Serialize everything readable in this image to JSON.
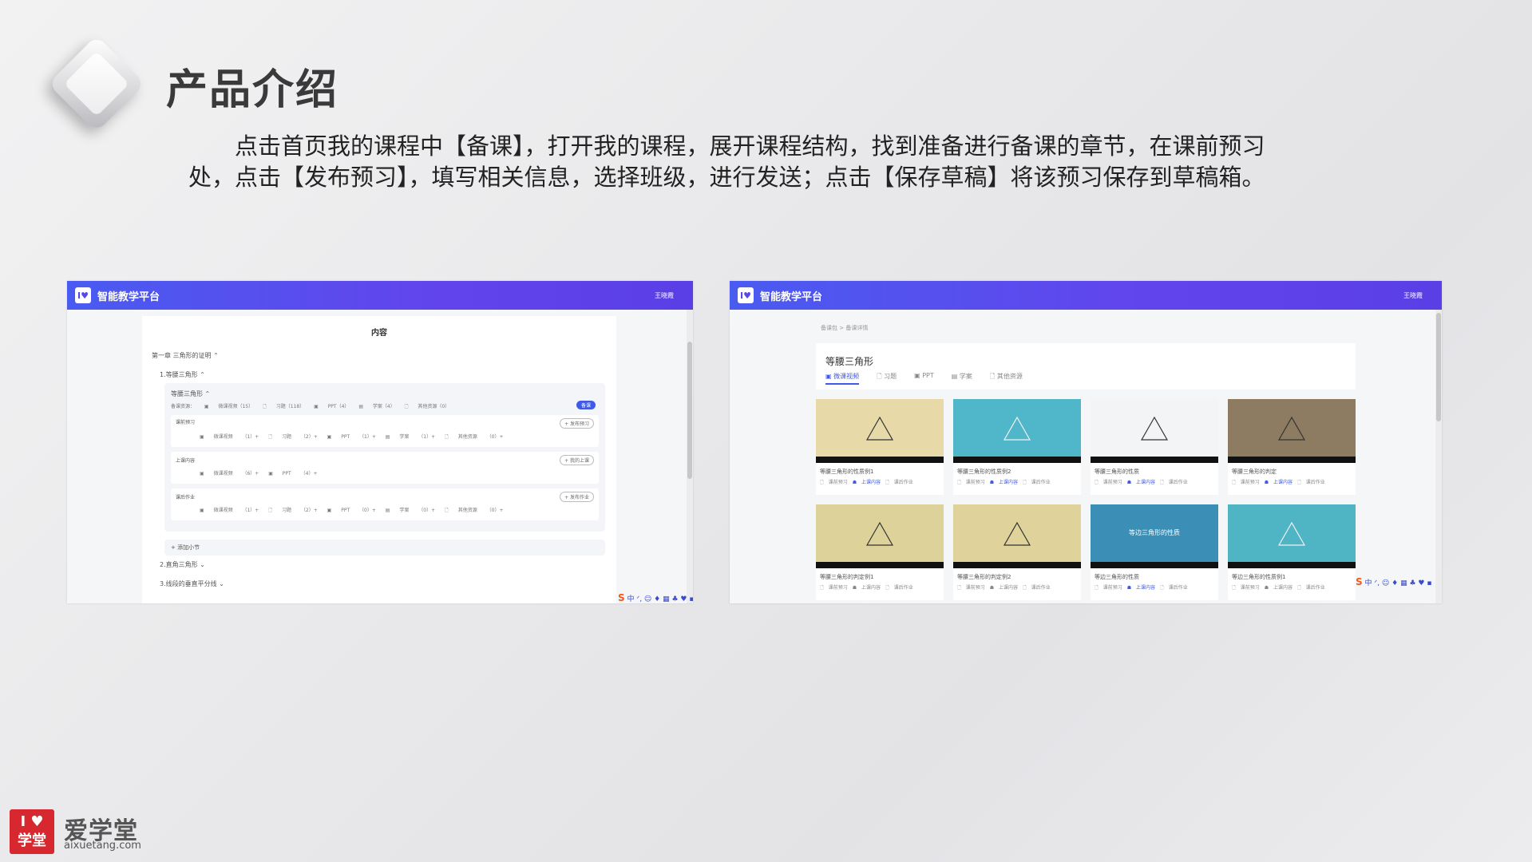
{
  "slide": {
    "title": "产品介绍",
    "intro": "点击首页我的课程中【备课】，打开我的课程，展开课程结构，找到准备进行备课的章节，在课前预习处，点击【发布预习】，填写相关信息，选择班级，进行发送；点击【保存草稿】将该预习保存到草稿箱。"
  },
  "app": {
    "name": "智能教学平台",
    "user": "王晓霞",
    "logo_text": "I♥"
  },
  "left_panel": {
    "header": "内容",
    "chapter": "第一章 三角形的证明 ⌃",
    "section1": "1.等腰三角形 ⌃",
    "sub1": "等腰三角形 ⌃",
    "resource_summary": "备课资源：  ▣ 微课视频（15）   🗋 习题（118）   ▣ PPT（4）   ▤ 学案（4）   🗋 其他资源（0）",
    "pill": "备课",
    "block1_label": "课前预习",
    "block1_btn": "+ 发布预习",
    "block1_res": "▣ 微课视频 （1）+   🗋 习题 （2）+   ▣ PPT （1）+   ▤ 学案 （1）+   🗋 其他资源 （0）+",
    "block2_label": "上课内容",
    "block2_btn": "+ 我的上课",
    "block2_res": "▣ 微课视频 （6）+   ▣ PPT （4）+",
    "block3_label": "课后作业",
    "block3_btn": "+ 发布作业",
    "block3_res": "▣ 微课视频 （1）+   🗋 习题 （2）+   ▣ PPT （0）+   ▤ 学案 （0）+   🗋 其他资源 （0）+",
    "add_section": "+ 添加小节",
    "section2": "2.直角三角形 ⌄",
    "section3": "3.线段的垂直平分线 ⌄"
  },
  "right_panel": {
    "breadcrumb": "备课包 > 备课详情",
    "title": "等腰三角形",
    "tabs": [
      "▣ 微课视频",
      "🗋 习题",
      "▣ PPT",
      "▤ 学案",
      "🗋 其他资源"
    ],
    "videos": [
      {
        "title": "等腰三角形的性质例1",
        "bg": "#e7d9a8"
      },
      {
        "title": "等腰三角形的性质例2",
        "bg": "#4fb7c9"
      },
      {
        "title": "等腰三角形的性质",
        "bg": "#f2f4f6"
      },
      {
        "title": "等腰三角形的判定",
        "bg": "#8d7b62"
      },
      {
        "title": "等腰三角形的判定例1",
        "bg": "#ddd39a"
      },
      {
        "title": "等腰三角形的判定例2",
        "bg": "#dfd29a"
      },
      {
        "title": "等边三角形的性质",
        "bg": "#3b8fb6"
      },
      {
        "title": "等边三角形的性质例1",
        "bg": "#4fb5c4"
      }
    ],
    "actions": [
      "🗋 课前预习",
      "☗ 上课内容",
      "🗋 课后作业"
    ],
    "video_banner": "等边三角形的性质"
  },
  "sogou_toolbar": "中 ᐟ, ☺ ♦ ▦ ♣ ♥ ▪",
  "sogou_s": "S",
  "brand": {
    "box_line1": "I ♥",
    "box_line2": "学堂",
    "name": "爱学堂",
    "url": "aixuetang.com"
  }
}
